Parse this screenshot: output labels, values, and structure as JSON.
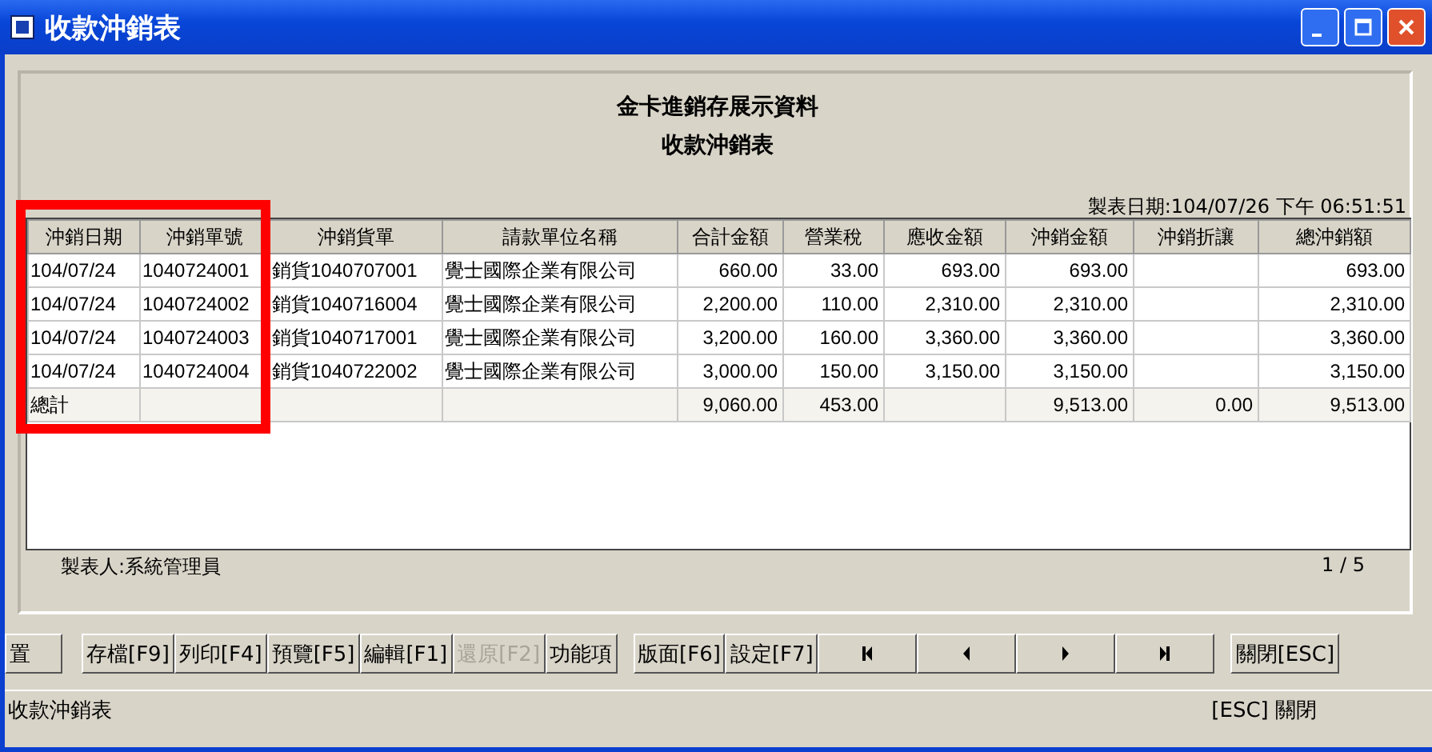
{
  "window": {
    "title": "收款沖銷表"
  },
  "report": {
    "company": "金卡進銷存展示資料",
    "title": "收款沖銷表",
    "printed_at": "製表日期:104/07/26 下午 06:51:51",
    "maker": "製表人:系統管理員",
    "page": "1 / 5"
  },
  "table": {
    "columns": [
      {
        "label": "沖銷日期",
        "highlighted": true
      },
      {
        "label": "沖銷單號",
        "highlighted": true
      },
      {
        "label": "沖銷貨單",
        "highlighted": false
      },
      {
        "label": "請款單位名稱",
        "highlighted": false
      },
      {
        "label": "合計金額",
        "highlighted": false
      },
      {
        "label": "營業稅",
        "highlighted": false
      },
      {
        "label": "應收金額",
        "highlighted": false
      },
      {
        "label": "沖銷金額",
        "highlighted": false
      },
      {
        "label": "沖銷折讓",
        "highlighted": false
      },
      {
        "label": "總沖銷額",
        "highlighted": false
      }
    ],
    "rows": [
      {
        "kind": "data",
        "cells": [
          "104/07/24",
          "1040724001",
          "銷貨1040707001",
          "覺士國際企業有限公司",
          "660.00",
          "33.00",
          "693.00",
          "693.00",
          "",
          "693.00"
        ]
      },
      {
        "kind": "data",
        "cells": [
          "104/07/24",
          "1040724002",
          "銷貨1040716004",
          "覺士國際企業有限公司",
          "2,200.00",
          "110.00",
          "2,310.00",
          "2,310.00",
          "",
          "2,310.00"
        ]
      },
      {
        "kind": "data",
        "cells": [
          "104/07/24",
          "1040724003",
          "銷貨1040717001",
          "覺士國際企業有限公司",
          "3,200.00",
          "160.00",
          "3,360.00",
          "3,360.00",
          "",
          "3,360.00"
        ]
      },
      {
        "kind": "data",
        "cells": [
          "104/07/24",
          "1040724004",
          "銷貨1040722002",
          "覺士國際企業有限公司",
          "3,000.00",
          "150.00",
          "3,150.00",
          "3,150.00",
          "",
          "3,150.00"
        ]
      },
      {
        "kind": "total",
        "cells": [
          "總計",
          "",
          "",
          "",
          "9,060.00",
          "453.00",
          "",
          "9,513.00",
          "0.00",
          "9,513.00"
        ]
      }
    ]
  },
  "buttons": [
    {
      "kind": "text",
      "label": "置",
      "disabled": false
    },
    {
      "kind": "text",
      "label": "存檔[F9]",
      "disabled": false
    },
    {
      "kind": "text",
      "label": "列印[F4]",
      "disabled": false
    },
    {
      "kind": "text",
      "label": "預覽[F5]",
      "disabled": false
    },
    {
      "kind": "text",
      "label": "編輯[F1]",
      "disabled": false
    },
    {
      "kind": "text",
      "label": "還原[F2]",
      "disabled": true
    },
    {
      "kind": "text",
      "label": "功能項",
      "disabled": false
    },
    {
      "kind": "text",
      "label": "版面[F6]",
      "disabled": false
    },
    {
      "kind": "text",
      "label": "設定[F7]",
      "disabled": false
    },
    {
      "kind": "first"
    },
    {
      "kind": "prev"
    },
    {
      "kind": "next"
    },
    {
      "kind": "last"
    },
    {
      "kind": "text",
      "label": "關閉[ESC]",
      "disabled": false
    }
  ],
  "status_bar": {
    "left": "收款沖銷表",
    "right": "[ESC] 關閉"
  }
}
